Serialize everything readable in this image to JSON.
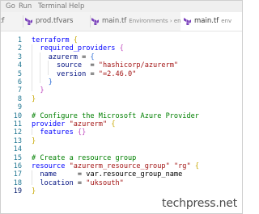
{
  "menu": [
    "Go",
    "Run",
    "Terminal",
    "Help"
  ],
  "tabs": [
    {
      "label": "tf",
      "sub": "",
      "active": false
    },
    {
      "label": "prod.tfvars",
      "sub": "",
      "active": false
    },
    {
      "label": "main.tf",
      "sub": "Environments › env",
      "active": false
    },
    {
      "label": "main.tf",
      "sub": "env",
      "active": true
    }
  ],
  "colors": {
    "tf_icon": "#7b42bc",
    "line_number": "#237893",
    "keyword": "#0000ff",
    "string": "#a31515",
    "comment": "#008000"
  },
  "editor": {
    "line_numbers": [
      "1",
      "2",
      "3",
      "4",
      "5",
      "6",
      "7",
      "8",
      "9",
      "10",
      "11",
      "12",
      "13",
      "14",
      "15",
      "16",
      "17",
      "18",
      "19"
    ],
    "lines": [
      [
        {
          "t": "terraform ",
          "c": "kw"
        },
        {
          "t": "{",
          "c": "b1"
        }
      ],
      [
        {
          "t": "  required_providers ",
          "c": "kw"
        },
        {
          "t": "{",
          "c": "b2"
        }
      ],
      [
        {
          "t": "    azurerm ",
          "c": "attr"
        },
        {
          "t": "= ",
          "c": "op"
        },
        {
          "t": "{",
          "c": "b3"
        }
      ],
      [
        {
          "t": "      source  ",
          "c": "attr"
        },
        {
          "t": "= ",
          "c": "op"
        },
        {
          "t": "\"hashicorp/azurerm\"",
          "c": "str"
        }
      ],
      [
        {
          "t": "      version ",
          "c": "attr"
        },
        {
          "t": "= ",
          "c": "op"
        },
        {
          "t": "\"=2.46.0\"",
          "c": "str"
        }
      ],
      [
        {
          "t": "    }",
          "c": "b3"
        }
      ],
      [
        {
          "t": "  }",
          "c": "b2"
        }
      ],
      [
        {
          "t": "}",
          "c": "b1"
        }
      ],
      [],
      [
        {
          "t": "# Configure the Microsoft Azure Provider",
          "c": "cm"
        }
      ],
      [
        {
          "t": "provider ",
          "c": "kw"
        },
        {
          "t": "\"azurerm\" ",
          "c": "str"
        },
        {
          "t": "{",
          "c": "b1"
        }
      ],
      [
        {
          "t": "  features ",
          "c": "kw"
        },
        {
          "t": "{}",
          "c": "b2"
        }
      ],
      [
        {
          "t": "}",
          "c": "b1"
        }
      ],
      [],
      [
        {
          "t": "# Create a resource group",
          "c": "cm"
        }
      ],
      [
        {
          "t": "resource ",
          "c": "kw"
        },
        {
          "t": "\"azurerm_resource_group\" ",
          "c": "str"
        },
        {
          "t": "\"rg\" ",
          "c": "str"
        },
        {
          "t": "{",
          "c": "b1"
        }
      ],
      [
        {
          "t": "  name     ",
          "c": "attr"
        },
        {
          "t": "= var.resource_group_name",
          "c": "op"
        }
      ],
      [
        {
          "t": "  location ",
          "c": "attr"
        },
        {
          "t": "= ",
          "c": "op"
        },
        {
          "t": "\"uksouth\"",
          "c": "str"
        }
      ],
      [
        {
          "t": "}",
          "c": "b1"
        }
      ]
    ]
  },
  "watermark": "techpress.net"
}
